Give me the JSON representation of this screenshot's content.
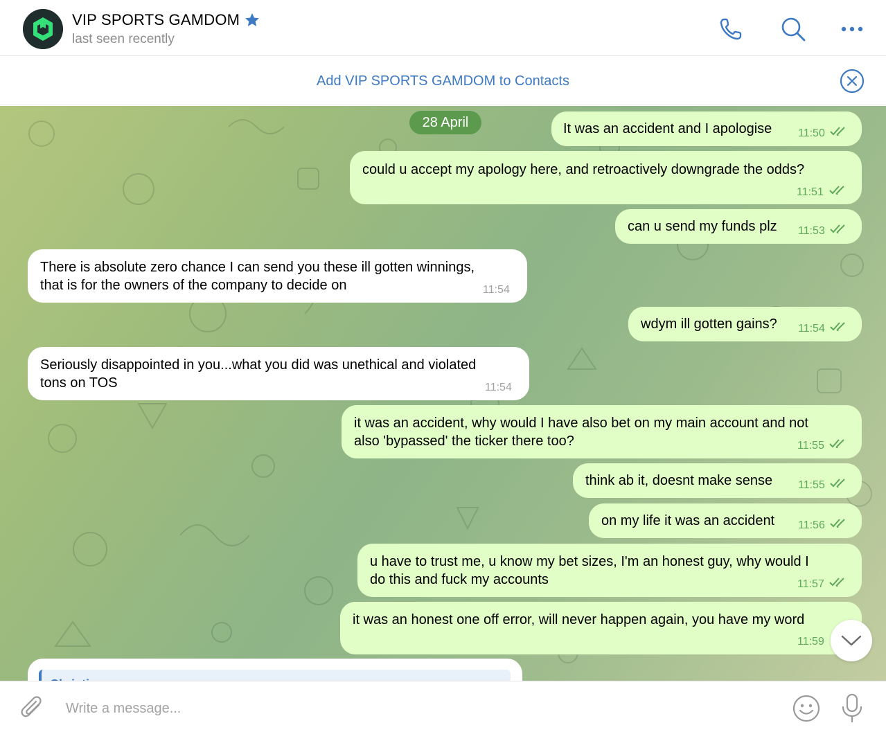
{
  "header": {
    "title": "VIP SPORTS GAMDOM",
    "subtitle": "last seen recently"
  },
  "add_contact": {
    "label": "Add VIP SPORTS GAMDOM to Contacts"
  },
  "chat": {
    "date_chip": "28 April",
    "messages": [
      {
        "dir": "out",
        "line1": "It was an accident and I apologise",
        "line2": "",
        "time": "11:50"
      },
      {
        "dir": "out",
        "line1": "could u accept my apology here, and retroactively downgrade the odds?",
        "line2": "",
        "time": "11:51"
      },
      {
        "dir": "out",
        "line1": "can u send my funds plz",
        "line2": "",
        "time": "11:53"
      },
      {
        "dir": "in",
        "line1": "There is absolute zero chance I can send you these ill gotten winnings,",
        "line2": "that is for the owners of the company to decide on",
        "time": "11:54"
      },
      {
        "dir": "out",
        "line1": "wdym ill gotten gains?",
        "line2": "",
        "time": "11:54"
      },
      {
        "dir": "in",
        "line1": "Seriously disappointed in you...what you did was unethical and violated",
        "line2": "tons on TOS",
        "time": "11:54"
      },
      {
        "dir": "out",
        "line1": "it was an accident, why would I have also bet on my main account and not",
        "line2": "also 'bypassed' the ticker there too?",
        "time": "11:55"
      },
      {
        "dir": "out",
        "line1": "think ab it, doesnt make sense",
        "line2": "",
        "time": "11:55"
      },
      {
        "dir": "out",
        "line1": "on my life it was an accident",
        "line2": "",
        "time": "11:56"
      },
      {
        "dir": "out",
        "line1": "u have to trust me, u know my bet sizes, I'm an honest guy, why would I",
        "line2": "do this and fuck my accounts",
        "time": "11:57"
      },
      {
        "dir": "out",
        "line1": "it was an honest one off error, will never happen again, you have my word",
        "line2": "",
        "time": "11:59"
      }
    ],
    "reply_preview_name": "Christian"
  },
  "composer": {
    "placeholder": "Write a message..."
  },
  "colors": {
    "accent": "#3e7ac3",
    "outgoing_bubble": "#e1fec6",
    "incoming_bubble": "#ffffff",
    "date_chip": "#5c9a4e",
    "check_marks": "#5fa85a"
  }
}
